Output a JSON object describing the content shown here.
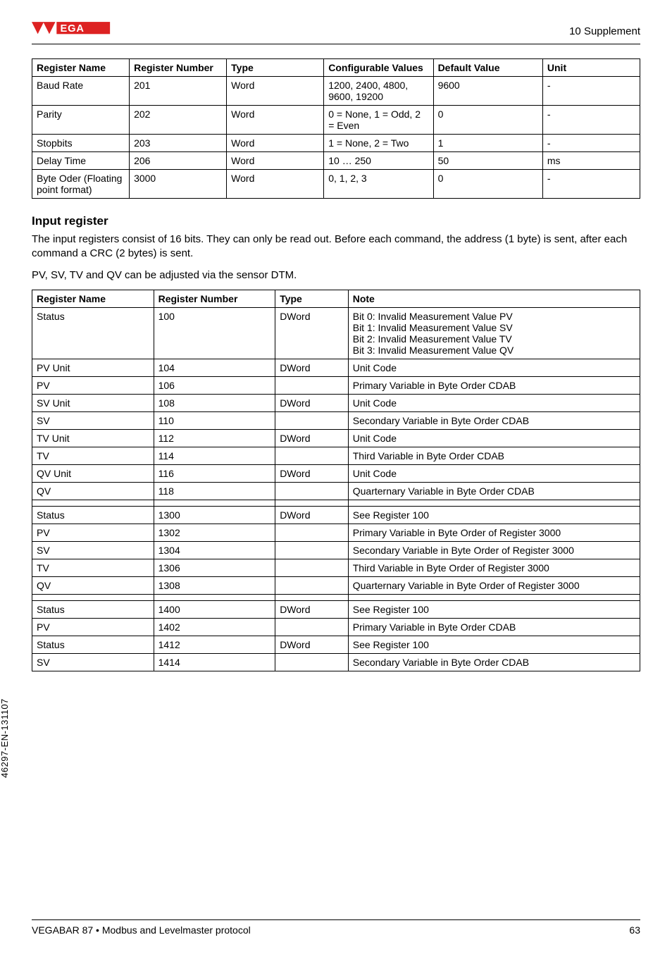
{
  "header": {
    "supplement": "10 Supplement"
  },
  "table1": {
    "headers": [
      "Register Name",
      "Register Number",
      "Type",
      "Configurable Values",
      "Default Value",
      "Unit"
    ],
    "rows": [
      [
        "Baud Rate",
        "201",
        "Word",
        "1200, 2400, 4800, 9600, 19200",
        "9600",
        "-"
      ],
      [
        "Parity",
        "202",
        "Word",
        "0 = None, 1 = Odd, 2 = Even",
        "0",
        "-"
      ],
      [
        "Stopbits",
        "203",
        "Word",
        "1 = None, 2 = Two",
        "1",
        "-"
      ],
      [
        "Delay Time",
        "206",
        "Word",
        "10 … 250",
        "50",
        "ms"
      ],
      [
        "Byte Oder (Floating point format)",
        "3000",
        "Word",
        "0, 1, 2, 3",
        "0",
        "-"
      ]
    ]
  },
  "section": {
    "title": "Input register",
    "para1": "The input registers consist of 16 bits. They can only be read out. Before each command, the address (1 byte) is sent, after each command a CRC (2 bytes) is sent.",
    "para2": "PV, SV, TV and QV can be adjusted via the sensor DTM."
  },
  "table2": {
    "headers": [
      "Register Name",
      "Register Number",
      "Type",
      "Note"
    ],
    "rows": [
      {
        "cells": [
          "Status",
          "100",
          "DWord",
          ""
        ],
        "notes": [
          "Bit 0: Invalid Measurement Value PV",
          "Bit 1: Invalid Measurement Value SV",
          "Bit 2: Invalid Measurement Value TV",
          "Bit 3: Invalid Measurement Value QV"
        ]
      },
      {
        "cells": [
          "PV Unit",
          "104",
          "DWord",
          "Unit Code"
        ]
      },
      {
        "cells": [
          "PV",
          "106",
          "",
          "Primary Variable in Byte Order CDAB"
        ]
      },
      {
        "cells": [
          "SV Unit",
          "108",
          "DWord",
          "Unit Code"
        ]
      },
      {
        "cells": [
          "SV",
          "110",
          "",
          "Secondary Variable in Byte Order CDAB"
        ]
      },
      {
        "cells": [
          "TV Unit",
          "112",
          "DWord",
          "Unit Code"
        ]
      },
      {
        "cells": [
          "TV",
          "114",
          "",
          "Third Variable in Byte Order CDAB"
        ]
      },
      {
        "cells": [
          "QV Unit",
          "116",
          "DWord",
          "Unit Code"
        ]
      },
      {
        "cells": [
          "QV",
          "118",
          "",
          "Quarternary Variable in Byte Order CDAB"
        ]
      },
      {
        "cells": [
          "",
          "",
          "",
          ""
        ]
      },
      {
        "cells": [
          "Status",
          "1300",
          "DWord",
          "See Register 100"
        ]
      },
      {
        "cells": [
          "PV",
          "1302",
          "",
          "Primary Variable in Byte Order of Register 3000"
        ]
      },
      {
        "cells": [
          "SV",
          "1304",
          "",
          "Secondary Variable in Byte Order of Register 3000"
        ]
      },
      {
        "cells": [
          "TV",
          "1306",
          "",
          "Third Variable in Byte Order of Register 3000"
        ]
      },
      {
        "cells": [
          "QV",
          "1308",
          "",
          "Quarternary Variable in Byte Order of Register 3000"
        ]
      },
      {
        "cells": [
          "",
          "",
          "",
          ""
        ]
      },
      {
        "cells": [
          "Status",
          "1400",
          "DWord",
          "See Register 100"
        ]
      },
      {
        "cells": [
          "PV",
          "1402",
          "",
          "Primary Variable in Byte Order CDAB"
        ]
      },
      {
        "cells": [
          "Status",
          "1412",
          "DWord",
          "See Register 100"
        ]
      },
      {
        "cells": [
          "SV",
          "1414",
          "",
          "Secondary Variable in Byte Order CDAB"
        ]
      }
    ]
  },
  "footer": {
    "left": "VEGABAR 87 • Modbus and Levelmaster protocol",
    "right": "63"
  },
  "sideid": "46297-EN-131107"
}
